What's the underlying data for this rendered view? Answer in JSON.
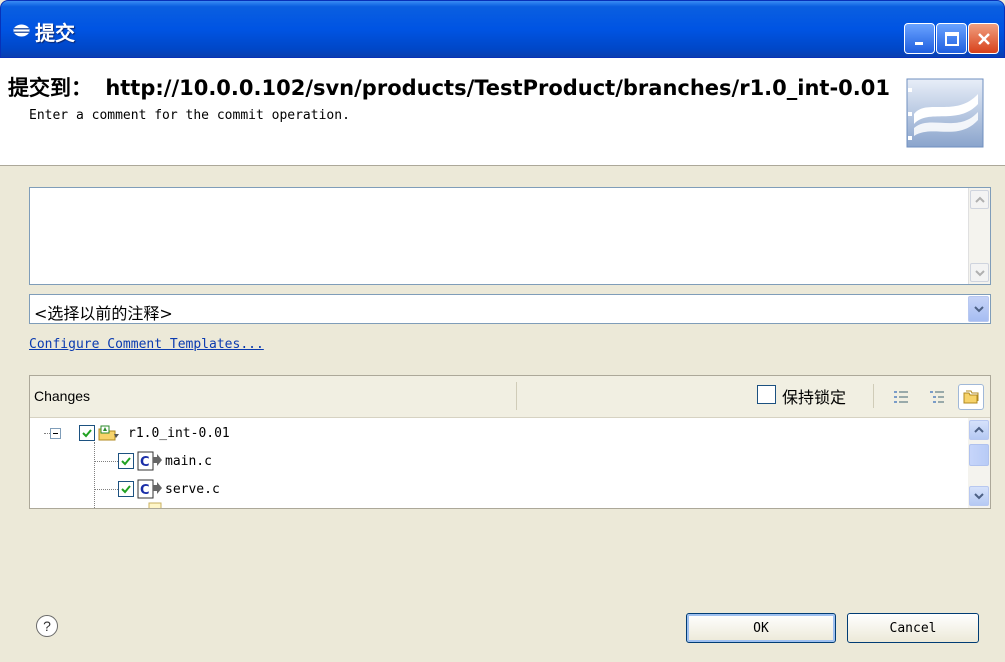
{
  "window": {
    "title": "提交",
    "title_icon": "eclipse-icon"
  },
  "header": {
    "heading_prefix": "提交到：",
    "heading_url": "http://10.0.0.102/svn/products/TestProduct/branches/r1.0_int-0.01",
    "description": "Enter a comment for the commit operation.",
    "logo": "subversion-logo"
  },
  "comment": {
    "value": "",
    "previous_comments_selected": "<选择以前的注释>"
  },
  "link": {
    "configure_templates": "Configure Comment Templates..."
  },
  "changes": {
    "title": "Changes",
    "keep_locks_label": "保持锁定",
    "keep_locks_checked": false,
    "tree": [
      {
        "label": "r1.0_int-0.01",
        "type": "folder",
        "checked": true,
        "expanded": true,
        "level": 0
      },
      {
        "label": "main.c",
        "type": "c-file",
        "checked": true,
        "level": 1
      },
      {
        "label": "serve.c",
        "type": "c-file",
        "checked": true,
        "level": 1
      }
    ]
  },
  "footer": {
    "ok_label": "OK",
    "cancel_label": "Cancel",
    "help_icon": "help-icon"
  },
  "colors": {
    "titlebar": "#0054e3",
    "link": "#0b3bb0",
    "dialog_bg": "#ece9d8"
  }
}
